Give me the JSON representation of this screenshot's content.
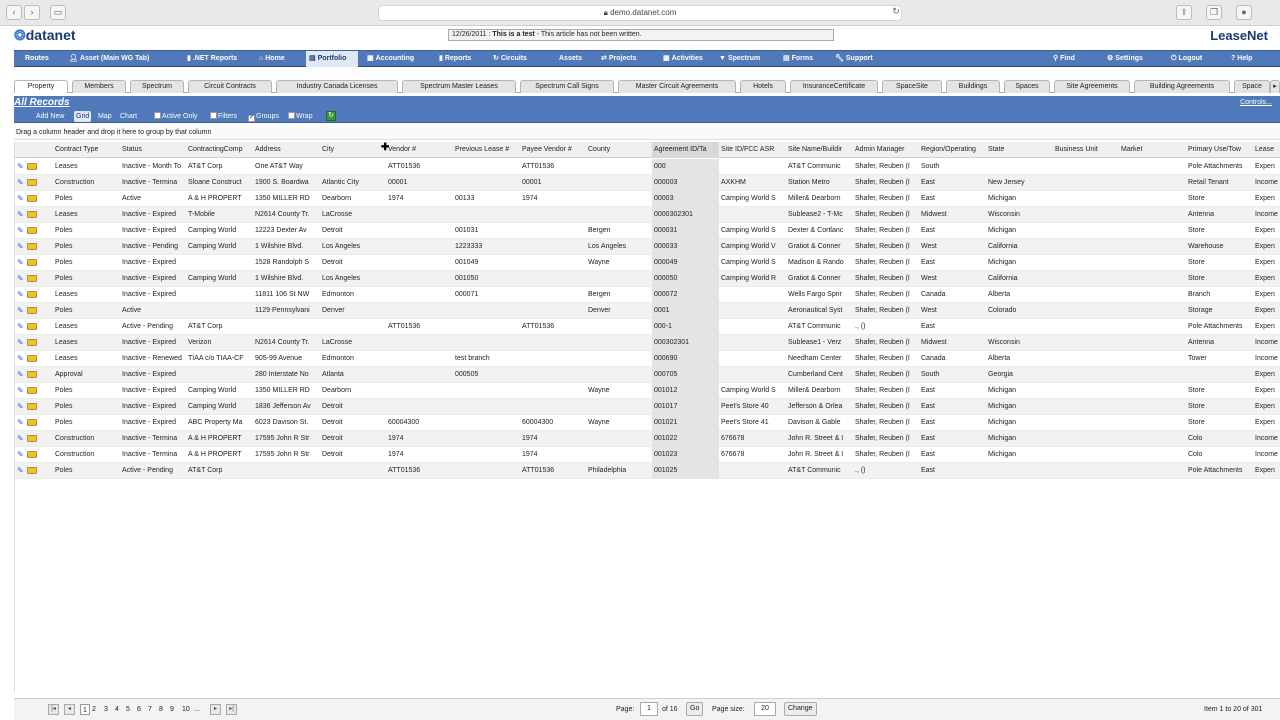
{
  "browser": {
    "url": "demo.datanet.com"
  },
  "brand": {
    "logo": "datanet",
    "product": "LeaseNet",
    "note_date": "12/26/2011 :",
    "note_title": "This is a test",
    "note_text": "- This article has not been written."
  },
  "nav": [
    {
      "label": "Routes",
      "icon": ""
    },
    {
      "label": "Asset (Main WG Tab)",
      "icon": "person-icon"
    },
    {
      "label": ".NET Reports",
      "icon": "chart-icon"
    },
    {
      "label": "Home",
      "icon": "home-icon"
    },
    {
      "label": "Portfolio",
      "icon": "folder-icon"
    },
    {
      "label": "Accounting",
      "icon": "ledger-icon"
    },
    {
      "label": "Reports",
      "icon": "chart-icon"
    },
    {
      "label": "Circuits",
      "icon": "circuit-icon"
    },
    {
      "label": "Assets",
      "icon": ""
    },
    {
      "label": "Projects",
      "icon": "projects-icon"
    },
    {
      "label": "Activities",
      "icon": "activities-icon"
    },
    {
      "label": "Spectrum",
      "icon": "spectrum-icon"
    },
    {
      "label": "Forms",
      "icon": "forms-icon"
    },
    {
      "label": "Support",
      "icon": "wrench-icon"
    }
  ],
  "nav_right": [
    {
      "label": "Find",
      "icon": "find-icon"
    },
    {
      "label": "Settings",
      "icon": "gear-icon"
    },
    {
      "label": "Logout",
      "icon": "logout-icon"
    },
    {
      "label": "Help",
      "icon": "help-icon"
    }
  ],
  "tabs": [
    "Property",
    "Members",
    "Spectrum",
    "Circuit Contracts",
    "Industry Canada Licenses",
    "Spectrum Master Leases",
    "Spectrum Call Signs",
    "Master Circuit Agreements",
    "Hotels",
    "InsuranceCertificate",
    "SpaceSite",
    "Buildings",
    "Spaces",
    "Site Agreements",
    "Building Agreements",
    "Space"
  ],
  "records": {
    "title": "All Records",
    "controls": "Controls..."
  },
  "toolbar": {
    "add_new": "Add New",
    "grid": "Grid",
    "map": "Map",
    "chart": "Chart",
    "active_only": "Active Only",
    "filters": "Filters",
    "groups": "Groups",
    "wrap": "Wrap"
  },
  "group_hint": "Drag a column header and drop it here to group by that column",
  "columns": [
    "Contract Type",
    "Status",
    "ContractingComp",
    "Address",
    "City",
    "Vendor #",
    "Previous Lease #",
    "Payee Vendor #",
    "County",
    "Agreement ID/Ta",
    "Site ID/FCC ASR",
    "Site Name/Buildir",
    "Admin Manager",
    "Region/Operating",
    "State",
    "Business Unit",
    "Market",
    "Primary Use/Tow",
    "Lease"
  ],
  "rows": [
    [
      "Leases",
      "Inactive - Month To",
      "AT&T Corp",
      "One AT&T Way",
      "",
      "ATT01536",
      "",
      "ATT01536",
      "",
      "000",
      "",
      "AT&T Communic",
      "Shafer, Reuben (I",
      "South",
      "",
      "",
      "",
      "Pole Attachments",
      "Expen"
    ],
    [
      "Construction",
      "Inactive - Termina",
      "Sloane Construct",
      "1900 S. Boardwa",
      "Atlantic City",
      "00001",
      "",
      "00001",
      "",
      "000003",
      "AXKHM",
      "Station Metro",
      "Shafer, Reuben (I",
      "East",
      "New Jersey",
      "",
      "",
      "Retail Tenant",
      "Income"
    ],
    [
      "Poles",
      "Active",
      "A & H PROPERT",
      "1350 MILLER RD",
      "Dearborn",
      "1974",
      "00133",
      "1974",
      "",
      "00003",
      "Camping World S",
      "Miller& Dearborn",
      "Shafer, Reuben (I",
      "East",
      "Michigan",
      "",
      "",
      "Store",
      "Expen"
    ],
    [
      "Leases",
      "Inactive - Expired",
      "T-Mobile",
      "N2614 County Tr.",
      "LaCrosse",
      "",
      "",
      "",
      "",
      "0000302301",
      "",
      "Sublease2 - T-Mc",
      "Shafer, Reuben (I",
      "Midwest",
      "Wisconsin",
      "",
      "",
      "Antenna",
      "Income"
    ],
    [
      "Poles",
      "Inactive - Expired",
      "Camping World",
      "12223 Dexter Av",
      "Detroit",
      "",
      "001031",
      "",
      "Bergen",
      "000031",
      "Camping World S",
      "Dexter & Cortlanc",
      "Shafer, Reuben (I",
      "East",
      "Michigan",
      "",
      "",
      "Store",
      "Expen"
    ],
    [
      "Poles",
      "Inactive - Pending",
      "Camping World",
      "1 Wilshire Blvd.",
      "Los Angeles",
      "",
      "1223333",
      "",
      "Los Angeles",
      "000033",
      "Camping World V",
      "Gratiot & Conner",
      "Shafer, Reuben (I",
      "West",
      "California",
      "",
      "",
      "Warehouse",
      "Expen"
    ],
    [
      "Poles",
      "Inactive - Expired",
      "",
      "1528 Randolph S",
      "Detroit",
      "",
      "001049",
      "",
      "Wayne",
      "000049",
      "Camping World S",
      "Madison & Rando",
      "Shafer, Reuben (I",
      "East",
      "Michigan",
      "",
      "",
      "Store",
      "Expen"
    ],
    [
      "Poles",
      "Inactive - Expired",
      "Camping World",
      "1 Wilshire Blvd.",
      "Los Angeles",
      "",
      "001050",
      "",
      "",
      "000050",
      "Camping World R",
      "Gratiot & Conner",
      "Shafer, Reuben (I",
      "West",
      "California",
      "",
      "",
      "Store",
      "Expen"
    ],
    [
      "Leases",
      "Inactive - Expired",
      "",
      "11811 106 St NW",
      "Edmonton",
      "",
      "000071",
      "",
      "Bergen",
      "000072",
      "",
      "Wells Fargo Sprir",
      "Shafer, Reuben (I",
      "Canada",
      "Alberta",
      "",
      "",
      "Branch",
      "Expen"
    ],
    [
      "Poles",
      "Active",
      "",
      "1129 Pennsylvani",
      "Denver",
      "",
      "",
      "",
      "Denver",
      "0001",
      "",
      "Aeronautical Syst",
      "Shafer, Reuben (I",
      "West",
      "Colorado",
      "",
      "",
      "Storage",
      "Expen"
    ],
    [
      "Leases",
      "Active - Pending",
      "AT&T Corp",
      "",
      "",
      "ATT01536",
      "",
      "ATT01536",
      "",
      "000-1",
      "",
      "AT&T Communic",
      "., ()",
      "East",
      "",
      "",
      "",
      "Pole Attachments",
      "Expen"
    ],
    [
      "Leases",
      "Inactive - Expired",
      "Verizon",
      "N2614 County Tr.",
      "LaCrosse",
      "",
      "",
      "",
      "",
      "000302301",
      "",
      "Sublease1 - Verz",
      "Shafer, Reuben (I",
      "Midwest",
      "Wisconsin",
      "",
      "",
      "Antenna",
      "Income"
    ],
    [
      "Leases",
      "Inactive - Renewed",
      "TIAA c/o TIAA-CF",
      "905-99 Avenue",
      "Edmonton",
      "",
      "test branch",
      "",
      "",
      "000690",
      "",
      "Needham Center",
      "Shafer, Reuben (I",
      "Canada",
      "Alberta",
      "",
      "",
      "Tower",
      "Income"
    ],
    [
      "Approval",
      "Inactive - Expired",
      "",
      "280 Interstate No",
      "Atlanta",
      "",
      "000505",
      "",
      "",
      "000705",
      "",
      "Cumberland Cent",
      "Shafer, Reuben (I",
      "South",
      "Georgia",
      "",
      "",
      "",
      "Expen"
    ],
    [
      "Poles",
      "Inactive - Expired",
      "Camping World",
      "1350 MILLER RD",
      "Dearborn",
      "",
      "",
      "",
      "Wayne",
      "001012",
      "Camping World S",
      "Miller& Dearborn",
      "Shafer, Reuben (I",
      "East",
      "Michigan",
      "",
      "",
      "Store",
      "Expen"
    ],
    [
      "Poles",
      "Inactive - Expired",
      "Camping World",
      "1836 Jefferson Av",
      "Detroit",
      "",
      "",
      "",
      "",
      "001017",
      "Peet's Store 40",
      "Jefferson & Orlea",
      "Shafer, Reuben (I",
      "East",
      "Michigan",
      "",
      "",
      "Store",
      "Expen"
    ],
    [
      "Poles",
      "Inactive - Expired",
      "ABC Property Ma",
      "6023 Davison St.",
      "Detroit",
      "60004300",
      "",
      "60004300",
      "Wayne",
      "001021",
      "Peet's Store 41",
      "Davison & Gable",
      "Shafer, Reuben (I",
      "East",
      "Michigan",
      "",
      "",
      "Store",
      "Expen"
    ],
    [
      "Construction",
      "Inactive - Termina",
      "A & H PROPERT",
      "17595 John R Str",
      "Detroit",
      "1974",
      "",
      "1974",
      "",
      "001022",
      "676678",
      "John R. Street & I",
      "Shafer, Reuben (I",
      "East",
      "Michigan",
      "",
      "",
      "Colo",
      "Income"
    ],
    [
      "Construction",
      "Inactive - Termina",
      "A & H PROPERT",
      "17595 John R Str",
      "Detroit",
      "1974",
      "",
      "1974",
      "",
      "001023",
      "676678",
      "John R. Street & I",
      "Shafer, Reuben (I",
      "East",
      "Michigan",
      "",
      "",
      "Colo",
      "Income"
    ],
    [
      "Poles",
      "Active - Pending",
      "AT&T Corp",
      "",
      "",
      "ATT01536",
      "",
      "ATT01536",
      "Philadelphia",
      "001025",
      "",
      "AT&T Communic",
      "., ()",
      "East",
      "",
      "",
      "",
      "Pole Attachments",
      "Expen"
    ]
  ],
  "pager": {
    "pages": [
      "1",
      "2",
      "3",
      "4",
      "5",
      "6",
      "7",
      "8",
      "9",
      "10",
      "..."
    ],
    "page_label": "Page:",
    "page_value": "1",
    "of_label": "of 16",
    "go": "Go",
    "size_label": "Page size:",
    "size_value": "20",
    "change": "Change",
    "summary": "Item 1 to 20 of 301"
  }
}
